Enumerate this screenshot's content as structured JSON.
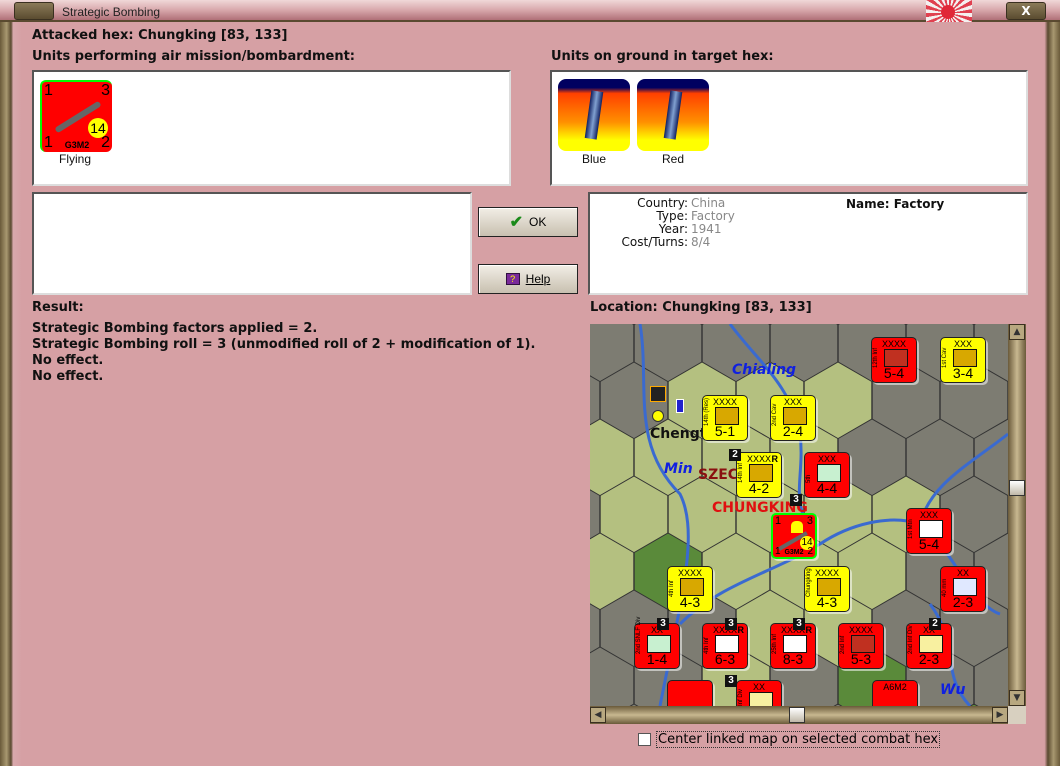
{
  "window": {
    "title": "Strategic Bombing",
    "close_label": "X"
  },
  "attacked_hex": "Attacked hex: Chungking  [83, 133]",
  "air_units": {
    "heading": "Units performing air mission/bombardment:",
    "units": [
      {
        "name": "G3M2",
        "top_left": "1",
        "top_right": "3",
        "bottom_left": "1",
        "bottom_right": "2",
        "range": "14",
        "caption": "Flying",
        "color": "#ff0000"
      }
    ]
  },
  "ground_units": {
    "heading": "Units on ground in target hex:",
    "units": [
      {
        "caption": "Blue"
      },
      {
        "caption": "Red"
      }
    ]
  },
  "buttons": {
    "ok": "OK",
    "help": "Help"
  },
  "target_info": {
    "country_label": "Country:",
    "country": "China",
    "type_label": "Type:",
    "type": "Factory",
    "year_label": "Year:",
    "year": "1941",
    "cost_label": "Cost/Turns:",
    "cost": "8/4",
    "name": "Name: Factory"
  },
  "result": {
    "heading": "Result:",
    "lines": [
      "Strategic Bombing factors applied = 2.",
      "Strategic Bombing roll = 3 (unmodified roll of 2 + modification of 1).",
      "No effect.",
      "No effect."
    ]
  },
  "location": "Location:  Chungking  [83, 133]",
  "map": {
    "labels": {
      "chialing": "Chialing",
      "min": "Min",
      "chengtu": "Chengt",
      "szechwan": "SZEC",
      "chungking": "CHUNGKING",
      "wu": "Wu"
    },
    "counters": [
      {
        "color": "#ff0000",
        "size": "XXXX",
        "str": "5-4",
        "side": "12th Inf",
        "sym": "#c03020"
      },
      {
        "color": "#ffff00",
        "size": "XXX",
        "str": "3-4",
        "side": "1st Cav",
        "sym": "#d8a800"
      },
      {
        "color": "#ffff00",
        "size": "XXXX",
        "str": "5-1",
        "side": "14th (Res)",
        "sym": "#d8a800"
      },
      {
        "color": "#ffff00",
        "size": "XXX",
        "str": "2-4",
        "side": "2nd Cav",
        "sym": "#d8a800"
      },
      {
        "color": "#ffff00",
        "size": "XXXX",
        "str": "4-2",
        "side": "14th Inf",
        "sym": "#d8a800",
        "r": "R"
      },
      {
        "color": "#ff0000",
        "size": "XXX",
        "str": "4-4",
        "side": "5th",
        "sym": "#c8f0d0"
      },
      {
        "color": "#ff0000",
        "size": "XXX",
        "str": "5-4",
        "side": "1st Mtn",
        "sym": "#ffffff"
      },
      {
        "color": "#ffff00",
        "size": "XXXX",
        "str": "4-3",
        "side": "4th Inf",
        "sym": "#d8a800"
      },
      {
        "color": "#ffff00",
        "size": "XXXX",
        "str": "4-3",
        "side": "Chungking",
        "sym": "#d8a800"
      },
      {
        "color": "#ff0000",
        "size": "XX",
        "str": "2-3",
        "side": "40 mm",
        "sym": "#e0e8ff"
      },
      {
        "color": "#ff0000",
        "size": "XX",
        "str": "1-4",
        "side": "2nd SNLF Div",
        "sym": "#c8f0d0"
      },
      {
        "color": "#ff0000",
        "size": "XXXX",
        "str": "6-3",
        "side": "4th Inf",
        "sym": "#ffffff",
        "r": "R"
      },
      {
        "color": "#ff0000",
        "size": "XXXX",
        "str": "8-3",
        "side": "25th Inf",
        "sym": "#ffffff",
        "r": "R"
      },
      {
        "color": "#ff0000",
        "size": "XXXX",
        "str": "5-3",
        "side": "2nd Inf",
        "sym": "#c03020"
      },
      {
        "color": "#ff0000",
        "size": "XX",
        "str": "2-3",
        "side": "2nd Inf Div",
        "sym": "#f8f0a0"
      },
      {
        "color": "#ff0000",
        "size": "",
        "str": "",
        "side": "",
        "sym": ""
      },
      {
        "color": "#ff0000",
        "size": "XX",
        "str": "",
        "side": "1 Inf Div",
        "sym": "#f8f0a0"
      },
      {
        "color": "#ff0000",
        "size": "A6M2",
        "str": "",
        "side": "",
        "sym": ""
      }
    ],
    "stacks": [
      "2",
      "3",
      "3",
      "3",
      "3",
      "2",
      "3"
    ],
    "bomber": {
      "name": "G3M2",
      "top_left": "1",
      "top_right": "3",
      "bottom_left": "1",
      "bottom_right": "2",
      "range": "14"
    }
  },
  "center_checkbox": {
    "label": "Center linked map on selected combat hex",
    "checked": false
  }
}
